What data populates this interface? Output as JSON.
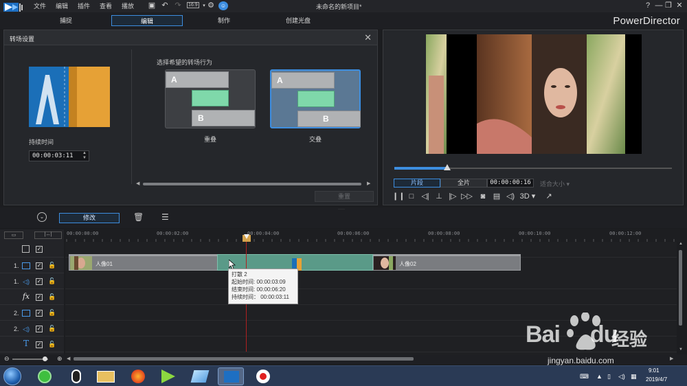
{
  "menubar": {
    "items": [
      "文件",
      "编辑",
      "插件",
      "查看",
      "播放"
    ],
    "window_title": "未命名的新项目*",
    "zoom_badge": "16:9",
    "window_controls": [
      "?",
      "—",
      "❐",
      "✕"
    ]
  },
  "tabs": [
    {
      "label": "捕捉"
    },
    {
      "label": "编辑"
    },
    {
      "label": "制作"
    },
    {
      "label": "创建光盘"
    }
  ],
  "brand": "PowerDirector",
  "transition_panel": {
    "title": "转场设置",
    "duration_label": "持续时间",
    "duration_value": "00:00:03:11",
    "choose_label": "选择希望的转场行为",
    "behaviors": [
      {
        "label": "重叠",
        "letter_a": "A",
        "letter_b": "B"
      },
      {
        "label": "交叠",
        "letter_a": "A",
        "letter_b": "B"
      }
    ],
    "reset_label": "重置"
  },
  "preview": {
    "clip_label": "片段",
    "full_label": "全片",
    "time": "00:00:00:16",
    "fit_label": "适合大小",
    "mode_3d": "3D",
    "progress": 0.19
  },
  "timeline": {
    "modify_label": "修改",
    "ruler_labels": [
      "00:00:00:00",
      "00:00:02:00",
      "00:00:04:00",
      "00:00:06:00",
      "00:00:08:00",
      "00:00:10:00",
      "00:00:12:00"
    ],
    "tracks": [
      {
        "num": "",
        "icon": "track-checkbox"
      },
      {
        "num": "1.",
        "icon": "video"
      },
      {
        "num": "1.",
        "icon": "audio"
      },
      {
        "num": "",
        "icon": "fx",
        "label": "fx"
      },
      {
        "num": "2.",
        "icon": "video"
      },
      {
        "num": "2.",
        "icon": "audio"
      },
      {
        "num": "",
        "icon": "title",
        "label": "T"
      }
    ],
    "clips": [
      {
        "name": "人像01"
      },
      {
        "name": "人像02"
      }
    ],
    "tooltip": {
      "line1": "打散 2",
      "line2": "起始时间: 00:00:03:09",
      "line3": "结束时间: 00:00:06:20",
      "line4": "持续时间： 00:00:03:11"
    }
  },
  "taskbar": {
    "time": "9:01",
    "date": "2019/4/7"
  },
  "watermark": {
    "brand": "Bai",
    "brand2": "du",
    "cn": "经验",
    "url": "jingyan.baidu.com"
  },
  "colors": {
    "accent": "#3d8ee0",
    "panel": "#25272b",
    "transition_clip": "#5a9a88"
  }
}
